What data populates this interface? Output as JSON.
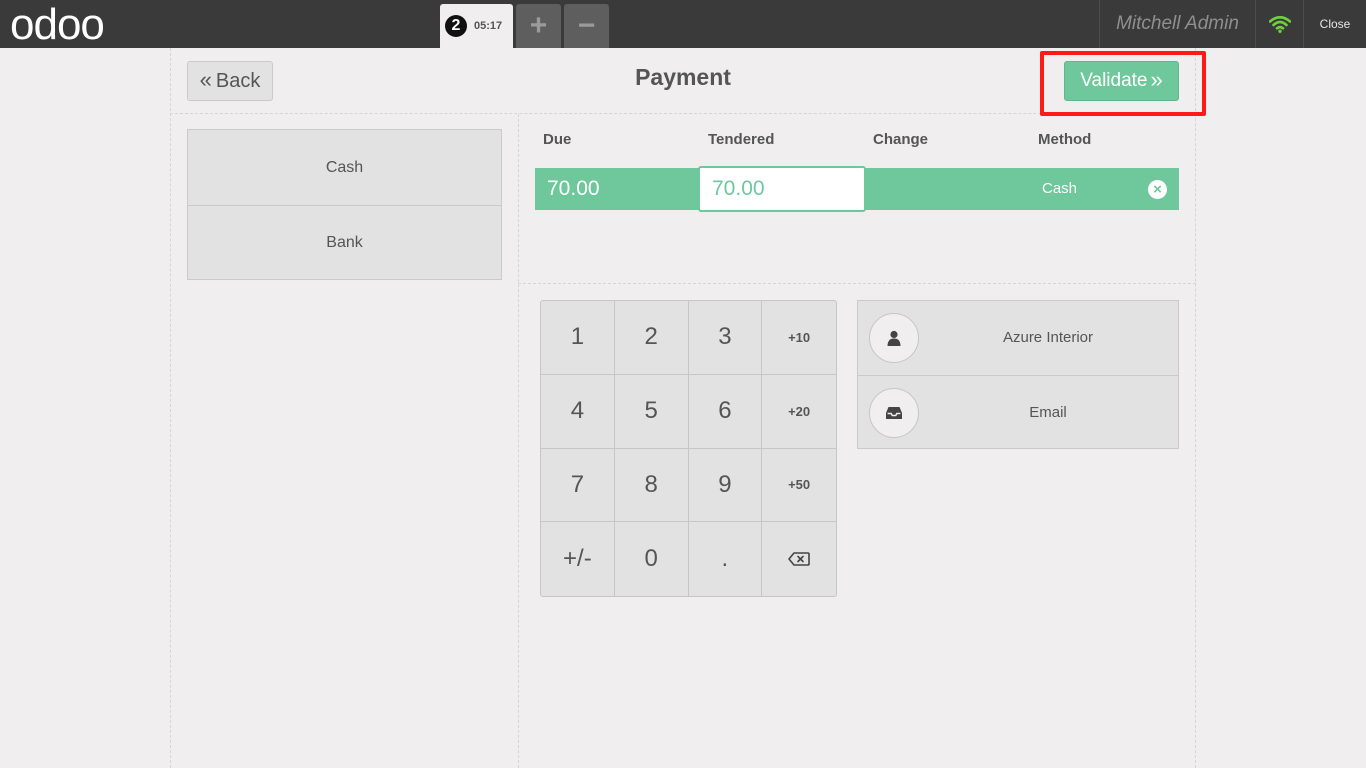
{
  "topbar": {
    "logo": "odoo",
    "order_number": "2",
    "order_time": "05:17",
    "add_order": "+",
    "remove_order": "−",
    "username": "Mitchell Admin",
    "close_label": "Close"
  },
  "header": {
    "back_label": "Back",
    "title": "Payment",
    "validate_label": "Validate"
  },
  "payment_methods": [
    "Cash",
    "Bank"
  ],
  "payment_lines": {
    "columns": [
      "Due",
      "Tendered",
      "Change",
      "Method"
    ],
    "rows": [
      {
        "due": "70.00",
        "tendered": "70.00",
        "change": "",
        "method": "Cash"
      }
    ]
  },
  "numpad": [
    "1",
    "2",
    "3",
    "+10",
    "4",
    "5",
    "6",
    "+20",
    "7",
    "8",
    "9",
    "+50",
    "+/-",
    "0",
    ".",
    "⌫"
  ],
  "extras": {
    "customer_label": "Azure Interior",
    "email_label": "Email"
  },
  "colors": {
    "accent": "#6ec89b",
    "topbar": "#3a3a3a",
    "highlight": "#ff1a1a",
    "wifi": "#6fcf3e"
  },
  "icons": {
    "back": "double-chevron-left-icon",
    "validate": "double-chevron-right-icon",
    "wifi": "wifi-icon",
    "delete_line": "close-circle-icon",
    "customer": "user-icon",
    "email": "inbox-icon",
    "backspace": "backspace-icon"
  }
}
